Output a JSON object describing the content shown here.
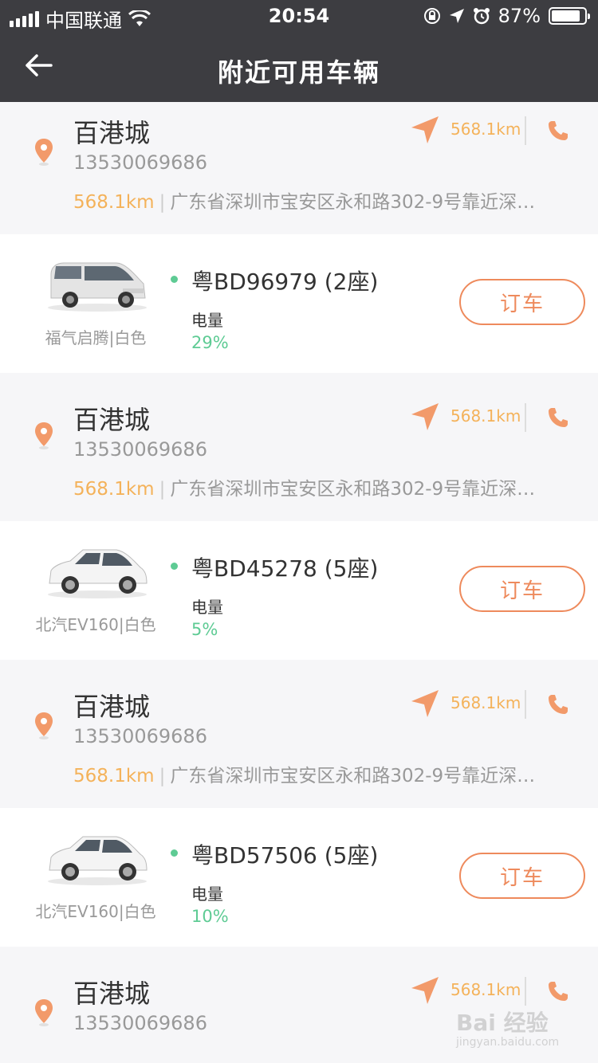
{
  "status_bar": {
    "carrier": "中国联通",
    "time": "20:54",
    "battery": "87%",
    "battery_level": 0.87
  },
  "nav": {
    "title": "附近可用车辆"
  },
  "stores": [
    {
      "name": "百港城",
      "phone": "13530069686",
      "distance": "568.1km",
      "address": "广东省深圳市宝安区永和路302-9号靠近深…"
    },
    {
      "name": "百港城",
      "phone": "13530069686",
      "distance": "568.1km",
      "address": "广东省深圳市宝安区永和路302-9号靠近深…"
    },
    {
      "name": "百港城",
      "phone": "13530069686",
      "distance": "568.1km",
      "address": "广东省深圳市宝安区永和路302-9号靠近深…"
    },
    {
      "name": "百港城",
      "phone": "13530069686",
      "distance": "568.1km",
      "address": ""
    }
  ],
  "cars": [
    {
      "model": "福气启腾|白色",
      "plate": "粤BD96979 (2座)",
      "charge_label": "电量",
      "charge": "29%",
      "button": "订车"
    },
    {
      "model": "北汽EV160|白色",
      "plate": "粤BD45278 (5座)",
      "charge_label": "电量",
      "charge": "5%",
      "button": "订车"
    },
    {
      "model": "北汽EV160|白色",
      "plate": "粤BD57506 (5座)",
      "charge_label": "电量",
      "charge": "10%",
      "button": "订车"
    }
  ],
  "colors": {
    "header": "#3d3d41",
    "accent_orange": "#ee8a5c",
    "distance_yellow": "#f4b25a",
    "charge_green": "#5ecb94"
  },
  "icons": {
    "back": "arrow-left-icon",
    "pin": "location-pin-icon",
    "navigate": "navigation-arrow-icon",
    "phone": "phone-icon"
  },
  "watermark": {
    "text": "Bai 经验",
    "sub": "jingyan.baidu.com"
  }
}
